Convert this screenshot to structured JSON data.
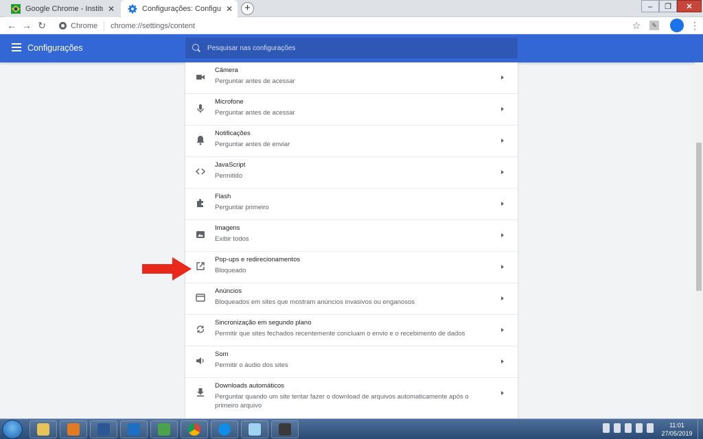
{
  "browser": {
    "tabs": [
      {
        "title": "Google Chrome - Instituto Nacio",
        "favicon": "flag-icon",
        "active": false
      },
      {
        "title": "Configurações: Configurações d",
        "favicon": "gear-icon",
        "active": true
      }
    ],
    "omnibox": {
      "chip": "Chrome",
      "url": "chrome://settings/content"
    },
    "accent": "#1a73e8"
  },
  "settings": {
    "title": "Configurações",
    "search_placeholder": "Pesquisar nas configurações",
    "header_color": "#3367d6",
    "rows": [
      {
        "title": "Câmera",
        "subtitle": "Perguntar antes de acessar",
        "icon": "camera-icon"
      },
      {
        "title": "Microfone",
        "subtitle": "Perguntar antes de acessar",
        "icon": "microphone-icon"
      },
      {
        "title": "Notificações",
        "subtitle": "Perguntar antes de enviar",
        "icon": "bell-icon"
      },
      {
        "title": "JavaScript",
        "subtitle": "Permitido",
        "icon": "code-icon"
      },
      {
        "title": "Flash",
        "subtitle": "Perguntar primeiro",
        "icon": "puzzle-icon"
      },
      {
        "title": "Imagens",
        "subtitle": "Exibir todos",
        "icon": "image-icon"
      },
      {
        "title": "Pop-ups e redirecionamentos",
        "subtitle": "Bloqueado",
        "icon": "open-in-new-icon"
      },
      {
        "title": "Anúncios",
        "subtitle": "Bloqueados em sites que mostram anúncios invasivos ou enganosos",
        "icon": "web-window-icon"
      },
      {
        "title": "Sincronização em segundo plano",
        "subtitle": "Permitir que sites fechados recentemente concluam o envio e o recebimento de dados",
        "icon": "sync-icon"
      },
      {
        "title": "Som",
        "subtitle": "Permitir o áudio dos sites",
        "icon": "speaker-icon"
      },
      {
        "title": "Downloads automáticos",
        "subtitle": "Perguntar quando um site tentar fazer o download de arquivos automaticamente após o primeiro arquivo",
        "icon": "download-icon"
      }
    ]
  },
  "annotation": {
    "color": "#e8291c",
    "icon": "red-arrow-icon"
  },
  "taskbar": {
    "apps": [
      "explorer-icon",
      "media-player-icon",
      "word-icon",
      "outlook-icon",
      "vnc-icon",
      "chrome-icon",
      "teamviewer-icon",
      "notepad-icon",
      "camera-app-icon"
    ],
    "time": "11:01",
    "date": "27/05/2019"
  }
}
